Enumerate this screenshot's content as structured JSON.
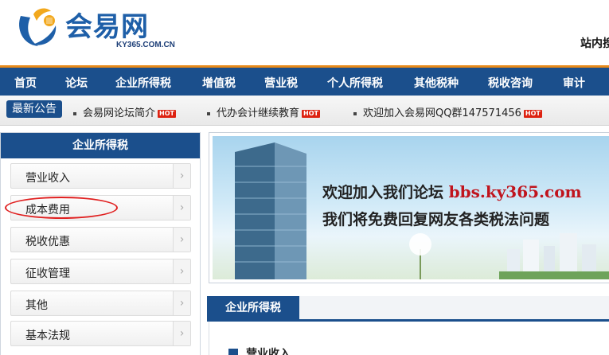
{
  "header": {
    "logo_text": "会易网",
    "logo_sub": "KY365.COM.CN",
    "site_search": "站内搜"
  },
  "nav": {
    "items": [
      "首页",
      "论坛",
      "企业所得税",
      "增值税",
      "营业税",
      "个人所得税",
      "其他税种",
      "税收咨询",
      "审计"
    ]
  },
  "notice": {
    "label": "最新公告",
    "hot": "HOT",
    "items": [
      "会易网论坛简介",
      "代办会计继续教育",
      "欢迎加入会易网QQ群147571456"
    ]
  },
  "sidebar": {
    "title": "企业所得税",
    "items": [
      {
        "label": "营业收入"
      },
      {
        "label": "成本费用"
      },
      {
        "label": "税收优惠"
      },
      {
        "label": "征收管理"
      },
      {
        "label": "其他"
      },
      {
        "label": "基本法规"
      }
    ],
    "arrow": "›"
  },
  "banner": {
    "line1": "欢迎加入我们论坛",
    "url": "bbs.ky365.com",
    "line2": "我们将免费回复网友各类税法问题"
  },
  "content": {
    "tab": "企业所得税",
    "subheading": "营业收入"
  },
  "colors": {
    "nav_blue": "#1b4f8c",
    "accent_orange": "#e88a1a",
    "highlight_red": "#e02020",
    "url_red": "#c0141d"
  }
}
